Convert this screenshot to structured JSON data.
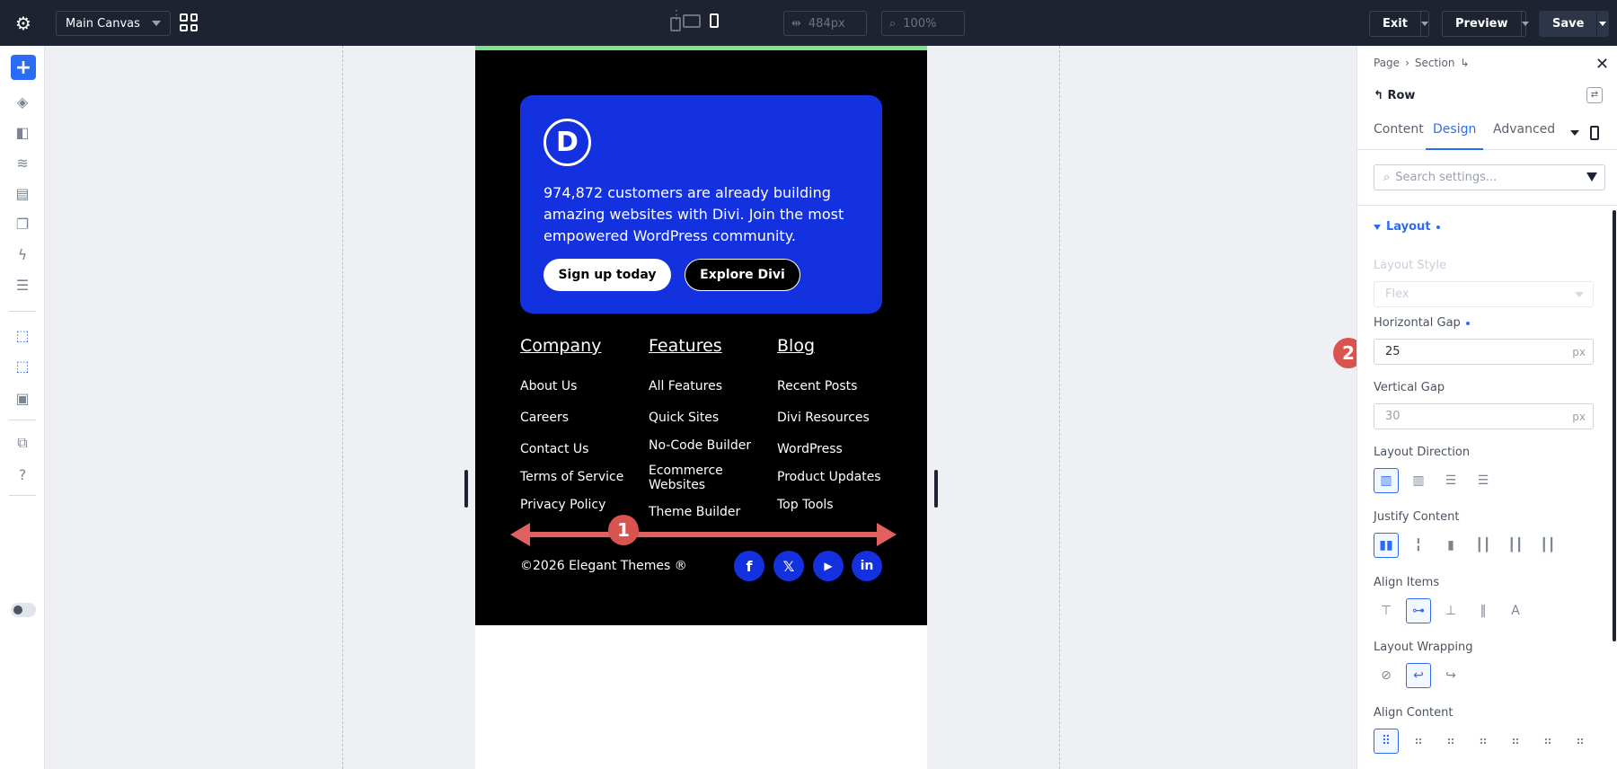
{
  "topbar": {
    "canvas_select": "Main Canvas",
    "width_value": "484px",
    "zoom_value": "100%",
    "exit_label": "Exit",
    "preview_label": "Preview",
    "save_label": "Save"
  },
  "cta": {
    "logo_letter": "D",
    "text": "974,872 customers are already building amazing websites with Divi. Join the most empowered WordPress community.",
    "signup_label": "Sign up today",
    "explore_label": "Explore Divi"
  },
  "columns": [
    {
      "heading": "Company",
      "links": [
        "About Us",
        "Careers",
        "Contact Us",
        "Terms of Service",
        "Privacy Policy"
      ]
    },
    {
      "heading": "Features",
      "links": [
        "All Features",
        "Quick Sites",
        "No-Code Builder",
        "Ecommerce Websites",
        "Theme Builder"
      ]
    },
    {
      "heading": "Blog",
      "links": [
        "Recent Posts",
        "Divi Resources",
        "WordPress",
        "Product Updates",
        "Top Tools"
      ]
    }
  ],
  "copyright": "©2026 Elegant Themes ®",
  "social": {
    "facebook": "f",
    "x": "𝕏",
    "youtube": "▶",
    "linkedin": "in"
  },
  "annotations": {
    "badge_1": "1",
    "badge_2": "2"
  },
  "panel": {
    "breadcrumb": [
      "Page",
      "›",
      "Section",
      "↳"
    ],
    "row_title": "Row",
    "tabs": [
      "Content",
      "Design",
      "Advanced"
    ],
    "search_placeholder": "Search settings...",
    "section": "Layout",
    "layout_style_label": "Layout Style",
    "layout_style_value": "Flex",
    "hgap_label": "Horizontal Gap",
    "hgap_value": "25",
    "vgap_label": "Vertical Gap",
    "vgap_value": "30",
    "unit": "px",
    "direction_label": "Layout Direction",
    "justify_label": "Justify Content",
    "align_items_label": "Align Items",
    "wrapping_label": "Layout Wrapping",
    "align_content_label": "Align Content"
  },
  "colors": {
    "accent": "#2b6cf6",
    "cta_blue": "#1431e0",
    "annotation_red": "#d9534f",
    "green_bar": "#7ce38a"
  }
}
